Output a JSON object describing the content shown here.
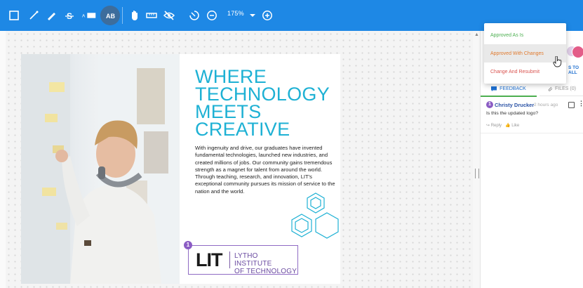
{
  "toolbar": {
    "icons": [
      "select-icon",
      "line-icon",
      "pen-icon",
      "strikethrough-icon",
      "text-box-icon",
      "text-select-icon",
      "hand-icon",
      "ruler-icon",
      "hide-icon",
      "undo-icon",
      "zoom-out-icon",
      "zoom-dropdown-icon",
      "zoom-in-icon"
    ],
    "zoom_level": "175%"
  },
  "document": {
    "title_lines": [
      "WHERE",
      "TECHNOLOGY",
      "MEETS",
      "CREATIVE"
    ],
    "body": "With ingenuity and drive, our graduates have invented fundamental technologies, launched new industries, and created millions of jobs. Our community gains tremendous strength as a magnet for talent from around the world. Through teaching, research, and innovation, LIT's exceptional community pursues its mission of service to the nation and the world.",
    "logo_mark": "LIT",
    "logo_line1": "LYTHO INSTITUTE",
    "logo_line2": "OF TECHNOLOGY",
    "annotation_number": "1"
  },
  "dropdown": {
    "items": [
      {
        "label": "Approved As Is",
        "color": "#4caf50"
      },
      {
        "label": "Approved With Changes",
        "color": "#e07a2e"
      },
      {
        "label": "Change And Resubmit",
        "color": "#d9534f"
      }
    ],
    "hovered_index": 1
  },
  "panel": {
    "header_right": "S TO ALL",
    "tabs": {
      "feedback": "FEEDBACK",
      "files": "FILES (0)"
    },
    "comment": {
      "number": "1",
      "author": "Christy Drucker",
      "time": "2 hours ago",
      "text": "Is this the updated logo?",
      "reply": "Reply",
      "like": "Like"
    }
  },
  "colors": {
    "toolbar": "#1e88e5",
    "accent": "#1eb1d4",
    "logo_purple": "#8b5cc4"
  }
}
